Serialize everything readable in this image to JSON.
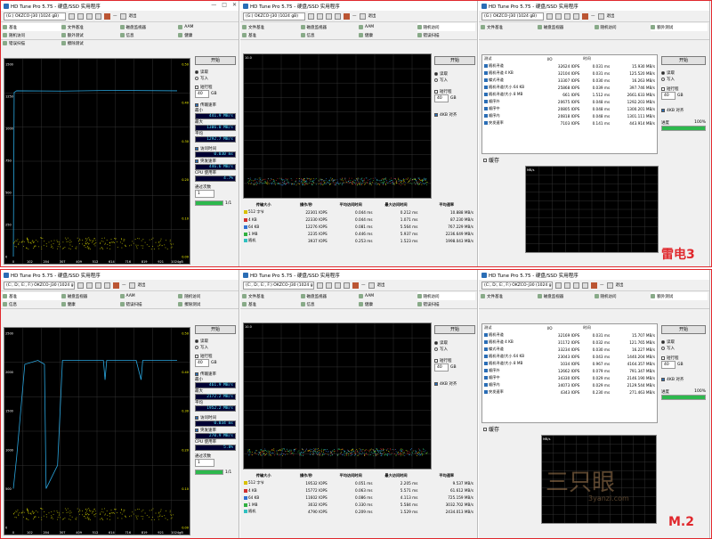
{
  "common": {
    "app_title": "HD Tune Pro 5.75 - 硬盘/SSD 实用程序",
    "drive_top": "(G:) OKZCO-J30 (1024 gB)",
    "drive_bot": "(C:, D:, E:, F:) OKZCO-J30 (1024 gB)",
    "temp": "—",
    "exit": "退出",
    "start": "开始",
    "read": "读取",
    "write": "写入",
    "short_stroke": "短行程",
    "gb": "GB",
    "short_value": "40",
    "transfer_rate": "传输速率",
    "min": "最小",
    "max": "最大",
    "avg": "平均",
    "access_time": "访问时间",
    "burst_rate": "突发速率",
    "cpu": "CPU 使用率",
    "passes": "通过次数",
    "passes_value": "1",
    "pass_of": "1/1",
    "align": "4KB 对齐",
    "speed_label": "进度",
    "speed_value": "100%",
    "cache": "缓存",
    "tabs": [
      "基准",
      "文件基准",
      "信息",
      "磁盘监视器",
      "健康",
      "AAM",
      "错误扫描",
      "随机访问",
      "擦除测试",
      "额外测试"
    ],
    "x_ticks": [
      "0",
      "102",
      "204",
      "307",
      "409",
      "512",
      "614",
      "716",
      "819",
      "921",
      "1024gB"
    ],
    "random_headers": [
      "传输大小",
      "操作/秒",
      "平均访问时间",
      "最大访问时间",
      "平均速率"
    ],
    "random_rows": [
      "512 字节",
      "4 KB",
      "64 KB",
      "1 MB",
      "随机"
    ],
    "random_colors": [
      "#d8c000",
      "#d03030",
      "#3070d0",
      "#30b040",
      "#30c0c0"
    ],
    "extra_headers": [
      "测试",
      "I/O",
      "时间",
      ""
    ],
    "extra_rows": [
      "随机寻道",
      "随机寻道 4 KB",
      "蝶式寻道",
      "随机寻道/大小 64 KB",
      "随机寻道/大小 8 MB",
      "顺序外",
      "顺序中",
      "顺序内",
      "突发速率"
    ],
    "mbs": "MB/s"
  },
  "top": {
    "label": "雷电3",
    "y_ticks": [
      "1500",
      "1250",
      "1000",
      "750",
      "500",
      "250",
      "0"
    ],
    "ms_ticks": [
      "0.50",
      "0.40",
      "0.30",
      "0.20",
      "0.10",
      "0.00"
    ],
    "min": "441.9 MB/s",
    "max": "1306.0 MB/s",
    "avg": "1292.7 MB/s",
    "access": "0.030 ms",
    "burst": "446.6 MB/s",
    "cpu": "4.7%",
    "random": [
      [
        "22301 IOPS",
        "0.044 ms",
        "0.212 ms",
        "10.888 MB/s"
      ],
      [
        "22330 IOPS",
        "0.044 ms",
        "1.071 ms",
        "87.230 MB/s"
      ],
      [
        "12276 IOPS",
        "0.081 ms",
        "5.564 ms",
        "767.229 MB/s"
      ],
      [
        "2235 IOPS",
        "0.446 ms",
        "5.937 ms",
        "2236.649 MB/s"
      ],
      [
        "3937 IOPS",
        "0.253 ms",
        "1.523 ms",
        "1998.043 MB/s"
      ]
    ],
    "extra": [
      [
        "32624 IOPS",
        "0.031 ms",
        "15.930 MB/s"
      ],
      [
        "32104 IOPS",
        "0.031 ms",
        "125.520 MB/s"
      ],
      [
        "33307 IOPS",
        "0.030 ms",
        "16.263 MB/s"
      ],
      [
        "25868 IOPS",
        "0.039 ms",
        "397.746 MB/s"
      ],
      [
        "661 IOPS",
        "1.512 ms",
        "2661.633 MB/s"
      ],
      [
        "20675 IOPS",
        "0.048 ms",
        "1292.203 MB/s"
      ],
      [
        "20805 IOPS",
        "0.048 ms",
        "1300.201 MB/s"
      ],
      [
        "20818 IOPS",
        "0.048 ms",
        "1301.111 MB/s"
      ],
      [
        "7103 IOPS",
        "0.141 ms",
        "443.914 MB/s"
      ]
    ],
    "rnd_ytick": "10.0"
  },
  "bot": {
    "label": "M.2",
    "y_ticks": [
      "2500",
      "2000",
      "1500",
      "1000",
      "500",
      "0"
    ],
    "ms_ticks": [
      "0.50",
      "0.40",
      "0.30",
      "0.20",
      "0.10",
      "0.00"
    ],
    "min": "461.9 MB/s",
    "max": "2172.2 MB/s",
    "avg": "1952.2 MB/s",
    "access": "0.034 ms",
    "burst": "270.9 MB/s",
    "cpu": "5.8%",
    "random": [
      [
        "19532 IOPS",
        "0.051 ms",
        "2.205 ms",
        "9.537 MB/s"
      ],
      [
        "15772 IOPS",
        "0.063 ms",
        "5.571 ms",
        "61.612 MB/s"
      ],
      [
        "11602 IOPS",
        "0.086 ms",
        "4.113 ms",
        "725.159 MB/s"
      ],
      [
        "3032 IOPS",
        "0.330 ms",
        "5.584 ms",
        "3032.702 MB/s"
      ],
      [
        "4790 IOPS",
        "0.209 ms",
        "1.529 ms",
        "2434.013 MB/s"
      ]
    ],
    "extra": [
      [
        "32169 IOPS",
        "0.031 ms",
        "15.707 MB/s"
      ],
      [
        "31172 IOPS",
        "0.032 ms",
        "121.765 MB/s"
      ],
      [
        "33234 IOPS",
        "0.030 ms",
        "16.227 MB/s"
      ],
      [
        "23043 IOPS",
        "0.043 ms",
        "1440.204 MB/s"
      ],
      [
        "1034 IOPS",
        "0.967 ms",
        "4164.357 MB/s"
      ],
      [
        "12662 IOPS",
        "0.079 ms",
        "791.347 MB/s"
      ],
      [
        "34330 IOPS",
        "0.029 ms",
        "2146.190 MB/s"
      ],
      [
        "34073 IOPS",
        "0.029 ms",
        "2129.544 MB/s"
      ],
      [
        "4343 IOPS",
        "0.230 ms",
        "271.463 MB/s"
      ]
    ],
    "rnd_ytick": "10.0"
  },
  "watermark": {
    "brand": "三只眼",
    "url": "3yanzi.com"
  },
  "chart_data": [
    {
      "type": "line",
      "title": "",
      "xlabel": "",
      "ylabel": "MB/s",
      "ylim": [
        0,
        1500
      ],
      "x": [
        0,
        1024
      ],
      "series": [
        {
          "values_approx": [
            1292,
            1292
          ]
        }
      ]
    },
    {
      "type": "line",
      "title": "",
      "xlabel": "",
      "ylabel": "MB/s",
      "ylim": [
        0,
        2500
      ],
      "x": [
        0,
        1024
      ],
      "series": [
        {
          "values_approx": [
            500,
            2100,
            2150,
            500,
            560,
            2150,
            2150,
            2150,
            2150
          ]
        }
      ]
    }
  ]
}
